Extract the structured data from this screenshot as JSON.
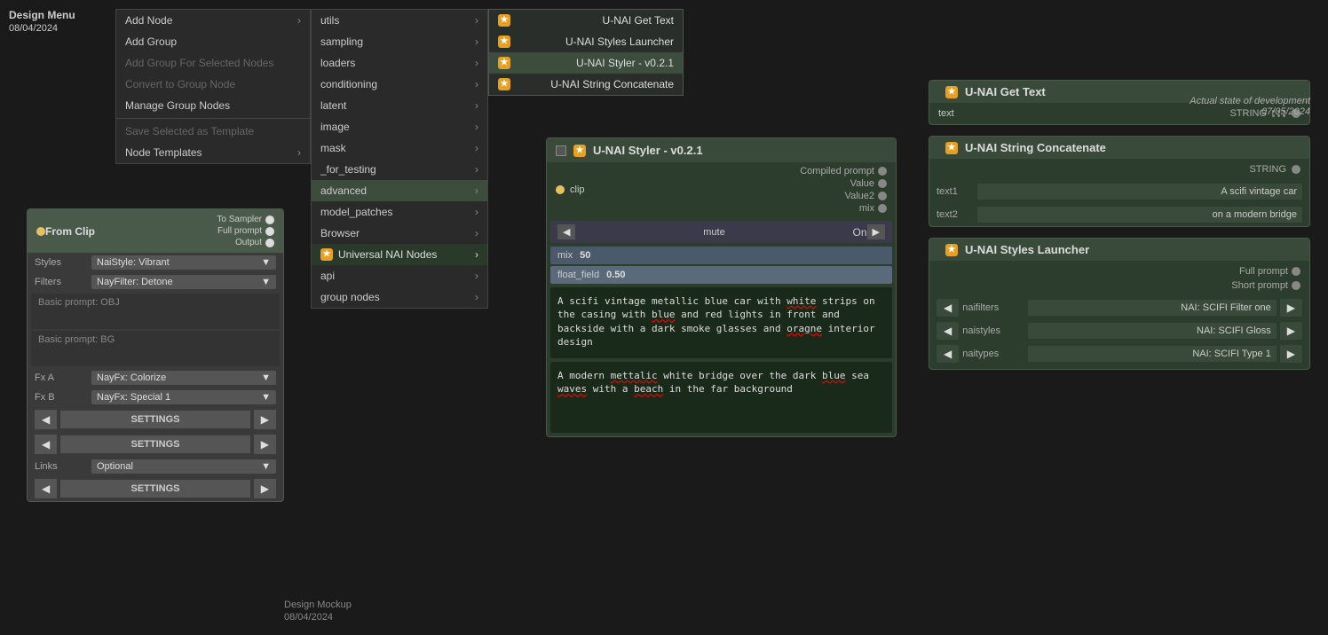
{
  "design_menu": {
    "title": "Design Menu",
    "date": "08/04/2024"
  },
  "menu_l1": {
    "items": [
      {
        "label": "Add Node",
        "has_submenu": true,
        "disabled": false
      },
      {
        "label": "Add Group",
        "has_submenu": false,
        "disabled": false
      },
      {
        "label": "Add Group For Selected Nodes",
        "has_submenu": false,
        "disabled": true
      },
      {
        "label": "Convert to Group Node",
        "has_submenu": false,
        "disabled": true
      },
      {
        "label": "Manage Group Nodes",
        "has_submenu": false,
        "disabled": false
      },
      {
        "label": "Save Selected as Template",
        "has_submenu": false,
        "disabled": true
      },
      {
        "label": "Node Templates",
        "has_submenu": true,
        "disabled": false
      }
    ]
  },
  "menu_l2": {
    "items": [
      {
        "label": "utils",
        "has_submenu": true
      },
      {
        "label": "sampling",
        "has_submenu": true
      },
      {
        "label": "loaders",
        "has_submenu": true
      },
      {
        "label": "conditioning",
        "has_submenu": true
      },
      {
        "label": "latent",
        "has_submenu": true
      },
      {
        "label": "image",
        "has_submenu": true
      },
      {
        "label": "mask",
        "has_submenu": true
      },
      {
        "label": "_for_testing",
        "has_submenu": true
      },
      {
        "label": "advanced",
        "has_submenu": true,
        "highlighted": true
      },
      {
        "label": "model_patches",
        "has_submenu": true
      },
      {
        "label": "Browser",
        "has_submenu": true
      },
      {
        "label": "Universal NAI Nodes",
        "has_submenu": true,
        "is_nai": true
      },
      {
        "label": "api",
        "has_submenu": true
      },
      {
        "label": "group nodes",
        "has_submenu": true
      }
    ]
  },
  "menu_l3": {
    "items": [
      {
        "label": "U-NAI Get Text",
        "icon": "★"
      },
      {
        "label": "U-NAI Styles Launcher",
        "icon": "★"
      },
      {
        "label": "U-NAI Styler - v0.2.1",
        "icon": "★",
        "highlighted": true
      },
      {
        "label": "U-NAI String Concatenate",
        "icon": "★"
      }
    ]
  },
  "from_clip_node": {
    "title": "From Clip",
    "connectors_right": [
      "To Sampler",
      "Full prompt",
      "Output"
    ],
    "fields": [
      {
        "label": "Styles",
        "value": "NaiStyle: Vibrant"
      },
      {
        "label": "Filters",
        "value": "NayFilter: Detone"
      }
    ],
    "basic_prompt_obj": "Basic prompt: OBJ",
    "basic_prompt_bg": "Basic prompt: BG",
    "fx_a": {
      "label": "Fx A",
      "value": "NayFx: Colorize"
    },
    "fx_b": {
      "label": "Fx B",
      "value": "NayFx: Special 1"
    },
    "links": {
      "label": "Links",
      "value": "Optional"
    },
    "settings_buttons": [
      "SETTINGS",
      "SETTINGS",
      "SETTINGS"
    ]
  },
  "unai_styler_node": {
    "title": "U-NAI Styler - v0.2.1",
    "icon": "★",
    "inputs": [
      {
        "label": "clip",
        "dot_color": "yellow"
      }
    ],
    "outputs": [
      {
        "label": "Compiled prompt"
      },
      {
        "label": "Value"
      },
      {
        "label": "Value2"
      },
      {
        "label": "mix"
      }
    ],
    "mute": {
      "label": "mute",
      "state": "On"
    },
    "mix": {
      "label": "mix",
      "value": "50"
    },
    "float_field": {
      "label": "float_field",
      "value": "0.50"
    },
    "text_area_1": "A scifi vintage metallic blue car with white strips on the casing with blue and red lights in front and backside with a dark smoke glasses and oragne interior design",
    "text_area_2": "A modern mettalic white bridge over the dark blue sea waves with a beach in the far background"
  },
  "unai_get_text_node": {
    "title": "U-NAI Get Text",
    "icon": "★",
    "output_label": "text",
    "output_type": "STRING"
  },
  "unai_string_concatenate_node": {
    "title": "U-NAI String Concatenate",
    "icon": "★",
    "output_type": "STRING",
    "text1_label": "text1",
    "text1_value": "A scifi vintage car",
    "text2_label": "text2",
    "text2_value": "on a modern bridge"
  },
  "unai_styles_launcher_node": {
    "title": "U-NAI Styles Launcher",
    "icon": "★",
    "outputs": [
      {
        "label": "Full prompt"
      },
      {
        "label": "Short prompt"
      }
    ],
    "naifilters": {
      "label": "naifilters",
      "value": "NAI: SCIFI Filter one"
    },
    "naistyles": {
      "label": "naistyles",
      "value": "NAI: SCIFI Gloss"
    },
    "naitypes": {
      "label": "naitypes",
      "value": "NAI: SCIFI Type 1"
    }
  },
  "state_label": {
    "text": "Actual state of development",
    "date": "07/05/2024"
  },
  "design_mockup": {
    "label": "Design Mockup",
    "date": "08/04/2024"
  }
}
